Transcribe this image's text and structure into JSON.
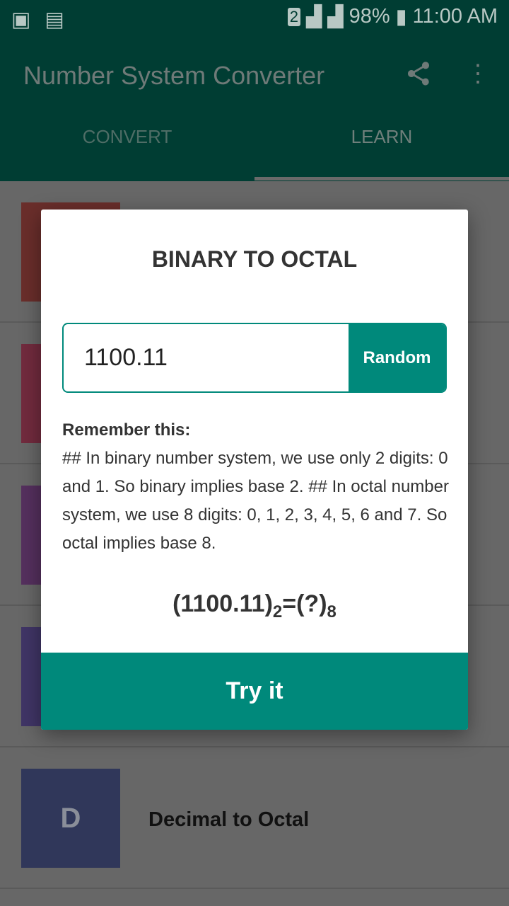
{
  "status": {
    "battery": "98%",
    "time": "11:00 AM",
    "sim": "2"
  },
  "appbar": {
    "title": "Number System Converter",
    "share_icon": "share-icon",
    "menu_icon": "more-vert-icon"
  },
  "tabs": [
    {
      "label": "CONVERT"
    },
    {
      "label": "LEARN",
      "active": true
    }
  ],
  "list": [
    {
      "letter": "",
      "label": "",
      "color": "#6a2e2b"
    },
    {
      "letter": "",
      "label": "",
      "color": "#722b3e"
    },
    {
      "letter": "",
      "label": "",
      "color": "#55305e"
    },
    {
      "letter": "",
      "label": "",
      "color": "#403566"
    },
    {
      "letter": "D",
      "label": "Decimal to Octal",
      "color": "#30375a"
    }
  ],
  "dialog": {
    "title": "BINARY TO OCTAL",
    "input_value": "1100.11",
    "random_label": "Random",
    "remember_heading": "Remember this:",
    "remember_text": "## In binary number system, we use only 2 digits: 0 and 1. So binary implies base 2. ## In octal number system, we use 8 digits: 0, 1, 2, 3, 4, 5, 6 and 7. So octal implies base 8.",
    "formula": {
      "left": "(1100.11)",
      "base_from": "2",
      "mid": "=(?)",
      "base_to": "8"
    },
    "try_label": "Try it"
  },
  "colors": {
    "primary_dark": "#003d33",
    "accent": "#00897b"
  }
}
